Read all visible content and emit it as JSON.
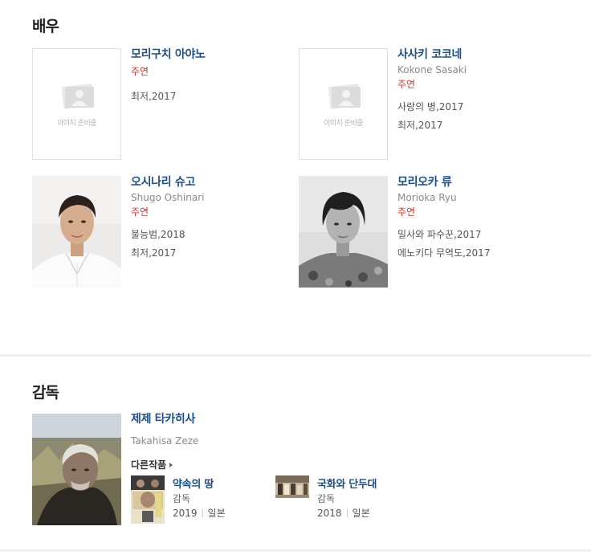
{
  "actors_section": {
    "title": "배우",
    "placeholder_text": "이미지 준비중",
    "actors": [
      {
        "name": "모리구치 아야노",
        "eng_name": "",
        "role": "주연",
        "works": [
          "최저,2017"
        ],
        "has_photo": false
      },
      {
        "name": "사사키 코코네",
        "eng_name": "Kokone Sasaki",
        "role": "주연",
        "works": [
          "사랑의 병,2017",
          "최저,2017"
        ],
        "has_photo": false
      },
      {
        "name": "오시나리 슈고",
        "eng_name": "Shugo Oshinari",
        "role": "주연",
        "works": [
          "불능범,2018",
          "최저,2017"
        ],
        "has_photo": true
      },
      {
        "name": "모리오카 류",
        "eng_name": "Morioka Ryu",
        "role": "주연",
        "works": [
          "밀사와 파수꾼,2017",
          "에노키다 무역도,2017"
        ],
        "has_photo": true
      }
    ]
  },
  "director_section": {
    "title": "감독",
    "name": "제제 타카히사",
    "eng_name": "Takahisa Zeze",
    "other_works_label": "다른작품",
    "films": [
      {
        "title": "약속의 땅",
        "credit": "감독",
        "year": "2019",
        "country": "일본"
      },
      {
        "title": "국화와 단두대",
        "credit": "감독",
        "year": "2018",
        "country": "일본"
      }
    ]
  },
  "colors": {
    "name_link": "#1b4e8a",
    "role": "#d3332a",
    "secondary_text": "#8a8a8a",
    "divider": "#f0f0f0"
  }
}
